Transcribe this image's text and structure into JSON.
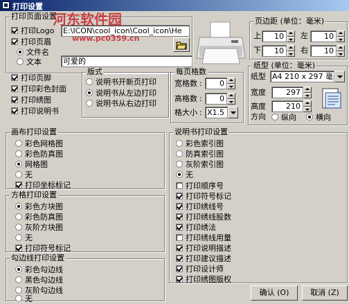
{
  "window": {
    "title": "打印设置"
  },
  "watermark": {
    "line1": "河东软件园",
    "line2": "www.pc0359.cn"
  },
  "print_page_settings": {
    "label": "打印页面设置",
    "print_logo": "打印Logo",
    "logo_path": "E:\\ICON\\cool_icon\\Cool_icon\\He",
    "print_header": "打印页眉",
    "filename": "文件名",
    "text": "文本",
    "text_value": "可爱的"
  },
  "checks": {
    "footer": "打印页脚",
    "color_cover": "打印彩色封面",
    "embroidery": "打印绣图",
    "manual": "打印说明书"
  },
  "layout": {
    "label": "版式",
    "opt1": "说明书开新页打印",
    "opt2": "说明书从左边打印",
    "opt3": "说明书从右边打印"
  },
  "grid": {
    "label": "每页格数",
    "width_label": "宽格数",
    "width_value": "0",
    "height_label": "高格数",
    "height_value": "0",
    "size_label": "格大小",
    "size_value": "X1.5"
  },
  "margins": {
    "label": "页边距 (单位：毫米)",
    "top_label": "上",
    "top_value": "10",
    "left_label": "左",
    "left_value": "10",
    "bottom_label": "下",
    "bottom_value": "10",
    "right_label": "右",
    "right_value": "10"
  },
  "paper": {
    "label": "纸型 (单位：毫米)",
    "type_label": "纸型",
    "type_value": "A4 210 x 297 毫",
    "width_label": "宽度",
    "width_value": "297",
    "height_label": "高度",
    "height_value": "210",
    "orient_label": "方向",
    "portrait": "纵向",
    "landscape": "横向"
  },
  "canvas": {
    "label": "画布打印设置",
    "opt1": "彩色网格图",
    "opt2": "彩色防真图",
    "opt3": "网格图",
    "opt4": "无",
    "check": "打印坐标标记"
  },
  "square": {
    "label": "方格打印设置",
    "opt1": "彩色方块图",
    "opt2": "彩色防真图",
    "opt3": "灰阶方块图",
    "opt4": "无",
    "check": "打印符号标记"
  },
  "backstitch": {
    "label": "勾边线打印设置",
    "opt1": "彩色勾边线",
    "opt2": "黑色勾边线",
    "opt3": "灰阶勾边线",
    "opt4": "无"
  },
  "manual_settings": {
    "label": "说明书打印设置",
    "opt1": "彩色索引图",
    "opt2": "防真索引图",
    "opt3": "灰阶索引图",
    "opt4": "无",
    "c1": "打印顺序号",
    "c2": "打印符号标记",
    "c3": "打印绣线号",
    "c4": "打印绣线股数",
    "c5": "打印绣法",
    "c6": "打印绣线用量",
    "c7": "打印说明描述",
    "c8": "打印建议描述",
    "c9": "打印设计师",
    "c10": "打印绣图版权"
  },
  "buttons": {
    "ok": "确认 (O)",
    "cancel": "取消 (Z)"
  },
  "colors": {
    "titlebar": "#0a246a",
    "face": "#d4d0c8",
    "watermark": "#c8282d"
  }
}
